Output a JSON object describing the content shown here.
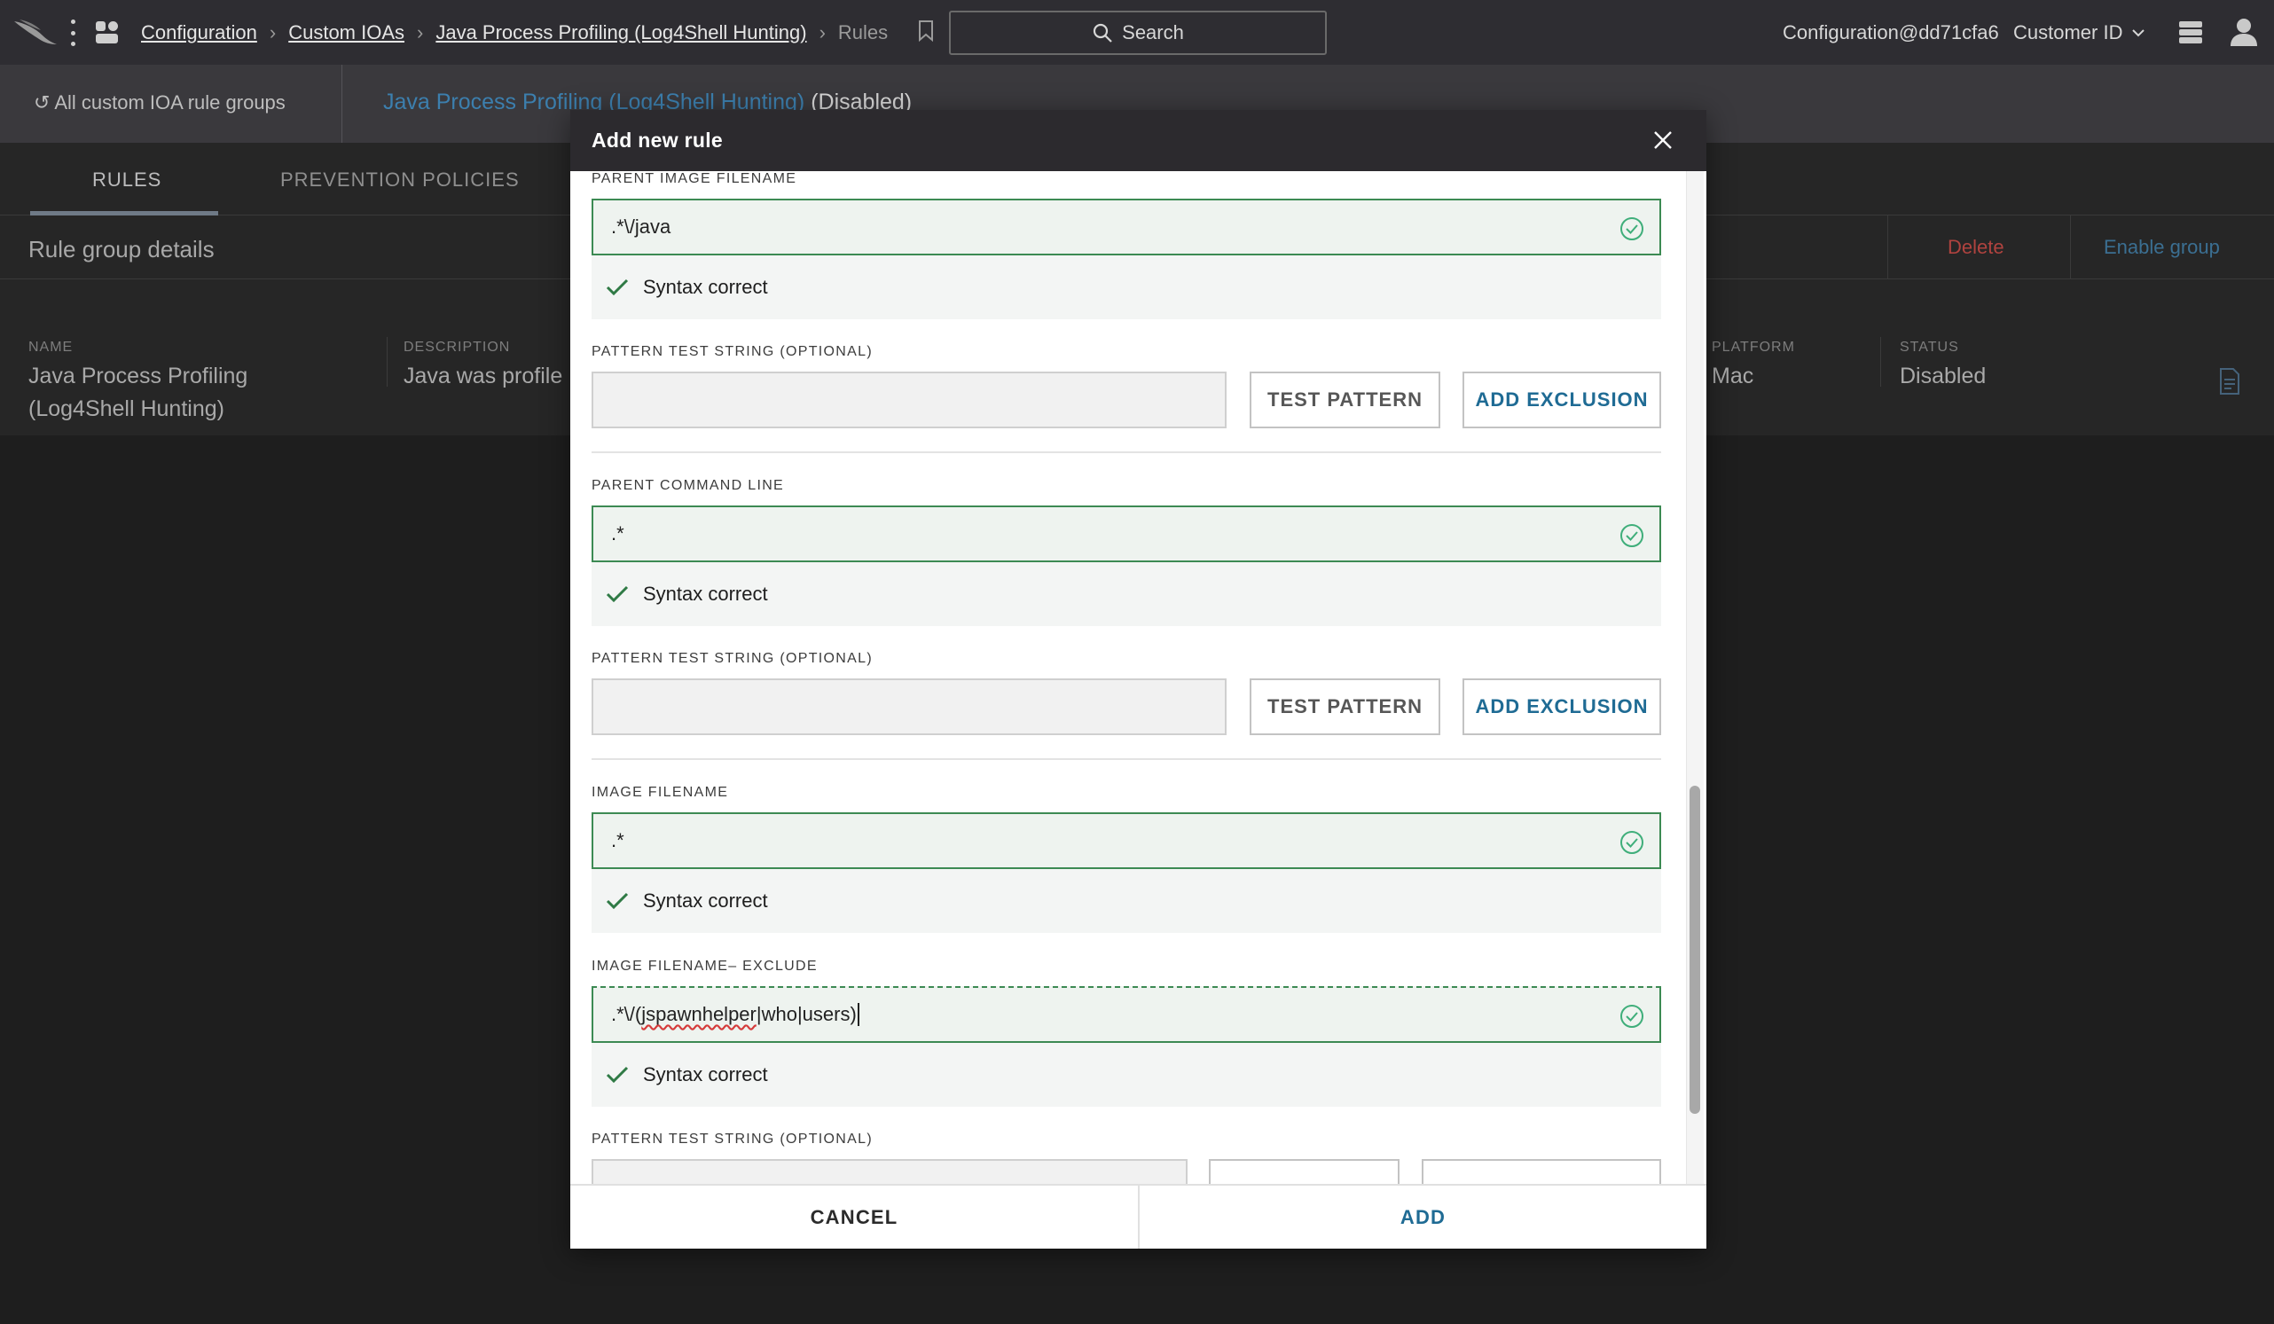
{
  "topbar": {
    "breadcrumbs": [
      "Configuration",
      "Custom IOAs",
      "Java Process Profiling (Log4Shell Hunting)"
    ],
    "current": "Rules",
    "search_label": "Search",
    "account": "Configuration@dd71cfa6",
    "customer": "Customer ID"
  },
  "subbar": {
    "back_label": "All custom IOA rule groups",
    "group_name": "Java Process Profiling (Log4Shell Hunting)",
    "group_state": "(Disabled)"
  },
  "tabs": [
    "RULES",
    "PREVENTION POLICIES"
  ],
  "rule_group": {
    "title": "Rule group details",
    "delete_label": "Delete",
    "enable_label": "Enable group",
    "name_label": "NAME",
    "name_value_line1": "Java Process Profiling",
    "name_value_line2": "(Log4Shell Hunting)",
    "description_label": "DESCRIPTION",
    "description_value": "Java was profile",
    "platform_label": "PLATFORM",
    "platform_value": "Mac",
    "status_label": "STATUS",
    "status_value": "Disabled"
  },
  "modal": {
    "title": "Add new rule",
    "syntax_ok": "Syntax correct",
    "test_label": "PATTERN TEST STRING (OPTIONAL)",
    "test_button": "TEST PATTERN",
    "exclusion_button": "ADD EXCLUSION",
    "fields": {
      "parent_image": {
        "label": "PARENT IMAGE FILENAME",
        "value": ".*\\/java"
      },
      "parent_cmd": {
        "label": "PARENT COMMAND LINE",
        "value": ".*"
      },
      "image": {
        "label": "IMAGE FILENAME",
        "value": ".*"
      },
      "image_exclude": {
        "label": "IMAGE FILENAME– EXCLUDE",
        "value_prefix": ".*\\/(",
        "value_typo": "jspawnhelper",
        "value_suffix": "|who|users)"
      }
    },
    "cancel_label": "CANCEL",
    "add_label": "ADD"
  },
  "colors": {
    "accent_blue": "#1f6b94",
    "valid_green": "#3c8a53",
    "danger_red": "#b0433f",
    "header_dark": "#2c2a2e"
  },
  "icons": [
    "falcon-logo-icon",
    "apps-icon",
    "bookmark-icon",
    "search-icon",
    "chevron-down-icon",
    "stack-icon",
    "user-icon",
    "undo-icon",
    "document-icon",
    "close-icon",
    "check-circle-icon",
    "checkmark-icon"
  ]
}
